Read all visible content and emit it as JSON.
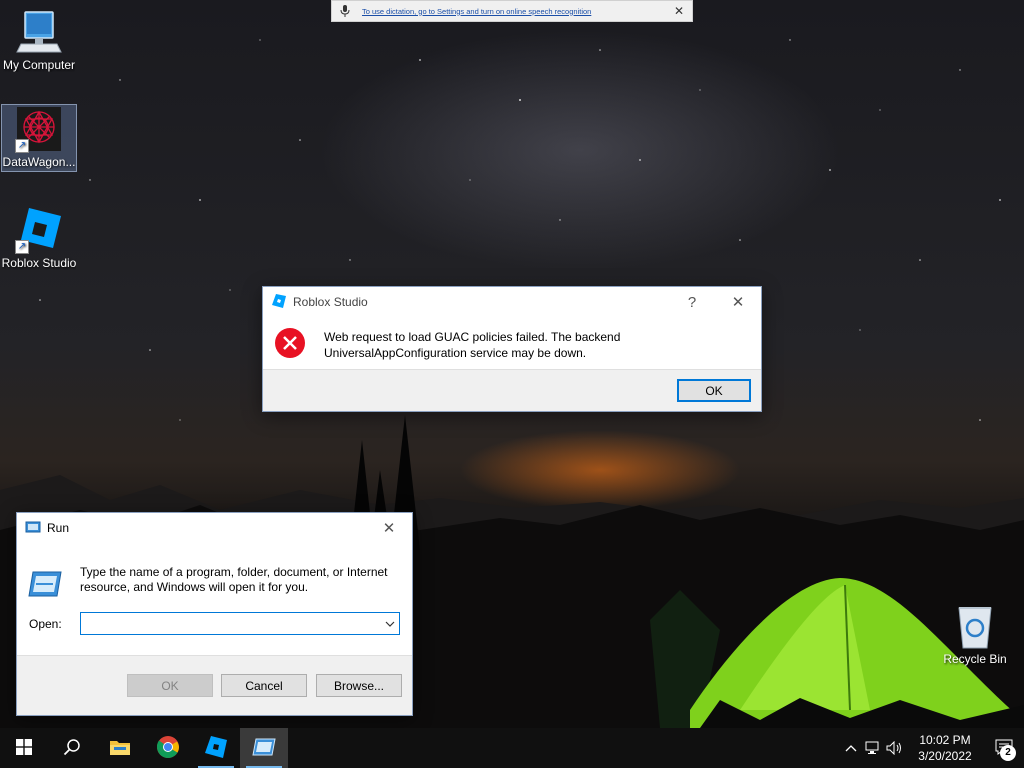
{
  "dictation": {
    "text": "To use dictation, go to Settings and turn on online speech recognition",
    "close_icon": "close-icon"
  },
  "desktop": {
    "icons": [
      {
        "label": "My Computer",
        "icon": "computer-icon"
      },
      {
        "label": "DataWagon...",
        "icon": "datawagon-icon",
        "selected": true
      },
      {
        "label": "Roblox Studio",
        "icon": "roblox-studio-icon"
      },
      {
        "label": "Recycle Bin",
        "icon": "recycle-bin-icon"
      }
    ]
  },
  "roblox_dialog": {
    "title": "Roblox Studio",
    "help": "?",
    "close": "✕",
    "message": "Web request to load GUAC policies failed. The backend UniversalAppConfiguration service may be down.",
    "ok_label": "OK",
    "colors": {
      "error": "#e81123"
    }
  },
  "run_dialog": {
    "title": "Run",
    "close": "✕",
    "description": "Type the name of a program, folder, document, or Internet resource, and Windows will open it for you.",
    "open_label": "Open:",
    "open_value": "",
    "ok_label": "OK",
    "cancel_label": "Cancel",
    "browse_label": "Browse..."
  },
  "taskbar": {
    "items": [
      {
        "name": "start-button",
        "icon": "windows-icon"
      },
      {
        "name": "search-button",
        "icon": "search-icon"
      },
      {
        "name": "file-explorer",
        "icon": "folder-icon"
      },
      {
        "name": "chrome",
        "icon": "chrome-icon"
      },
      {
        "name": "roblox-studio",
        "icon": "roblox-studio-icon"
      },
      {
        "name": "run",
        "icon": "run-icon"
      }
    ],
    "time": "10:02 PM",
    "date": "3/20/2022",
    "notification_count": "2",
    "colors": {
      "background": "#101010",
      "accent": "#76b9ed"
    }
  }
}
